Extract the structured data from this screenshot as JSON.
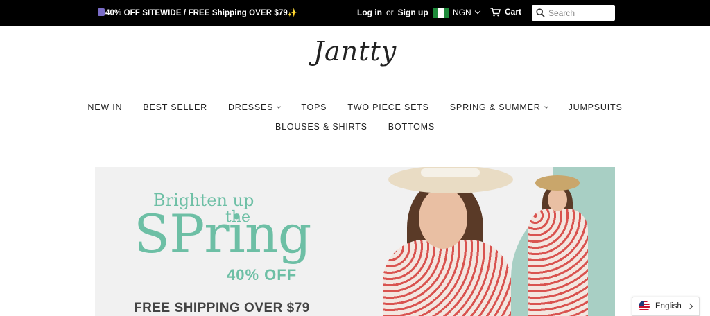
{
  "topbar": {
    "promo_text": "40% OFF SITEWIDE / FREE Shipping OVER $79",
    "login_label": "Log in",
    "or_label": "or",
    "signup_label": "Sign up",
    "currency_code": "NGN",
    "cart_label": "Cart",
    "search_placeholder": "Search"
  },
  "brand": {
    "logo_text": "Jantty"
  },
  "nav": {
    "row1": [
      {
        "label": "NEW IN",
        "has_dropdown": false
      },
      {
        "label": "BEST SELLER",
        "has_dropdown": false
      },
      {
        "label": "DRESSES",
        "has_dropdown": true
      },
      {
        "label": "TOPS",
        "has_dropdown": false
      },
      {
        "label": "TWO PIECE SETS",
        "has_dropdown": false
      },
      {
        "label": "SPRING & SUMMER",
        "has_dropdown": true
      },
      {
        "label": "JUMPSUITS",
        "has_dropdown": false
      }
    ],
    "row2": [
      {
        "label": "BLOUSES & SHIRTS",
        "has_dropdown": false
      },
      {
        "label": "BOTTOMS",
        "has_dropdown": false
      }
    ]
  },
  "hero": {
    "line1": "Brighten up",
    "line2": "the",
    "headline": "SPring",
    "discount": "40% OFF",
    "shipping": "FREE SHIPPING OVER $79",
    "accent_color": "#6dbfa5",
    "panel_color": "#a8cfc4"
  },
  "language": {
    "current": "English",
    "icon": "us-flag-icon"
  }
}
